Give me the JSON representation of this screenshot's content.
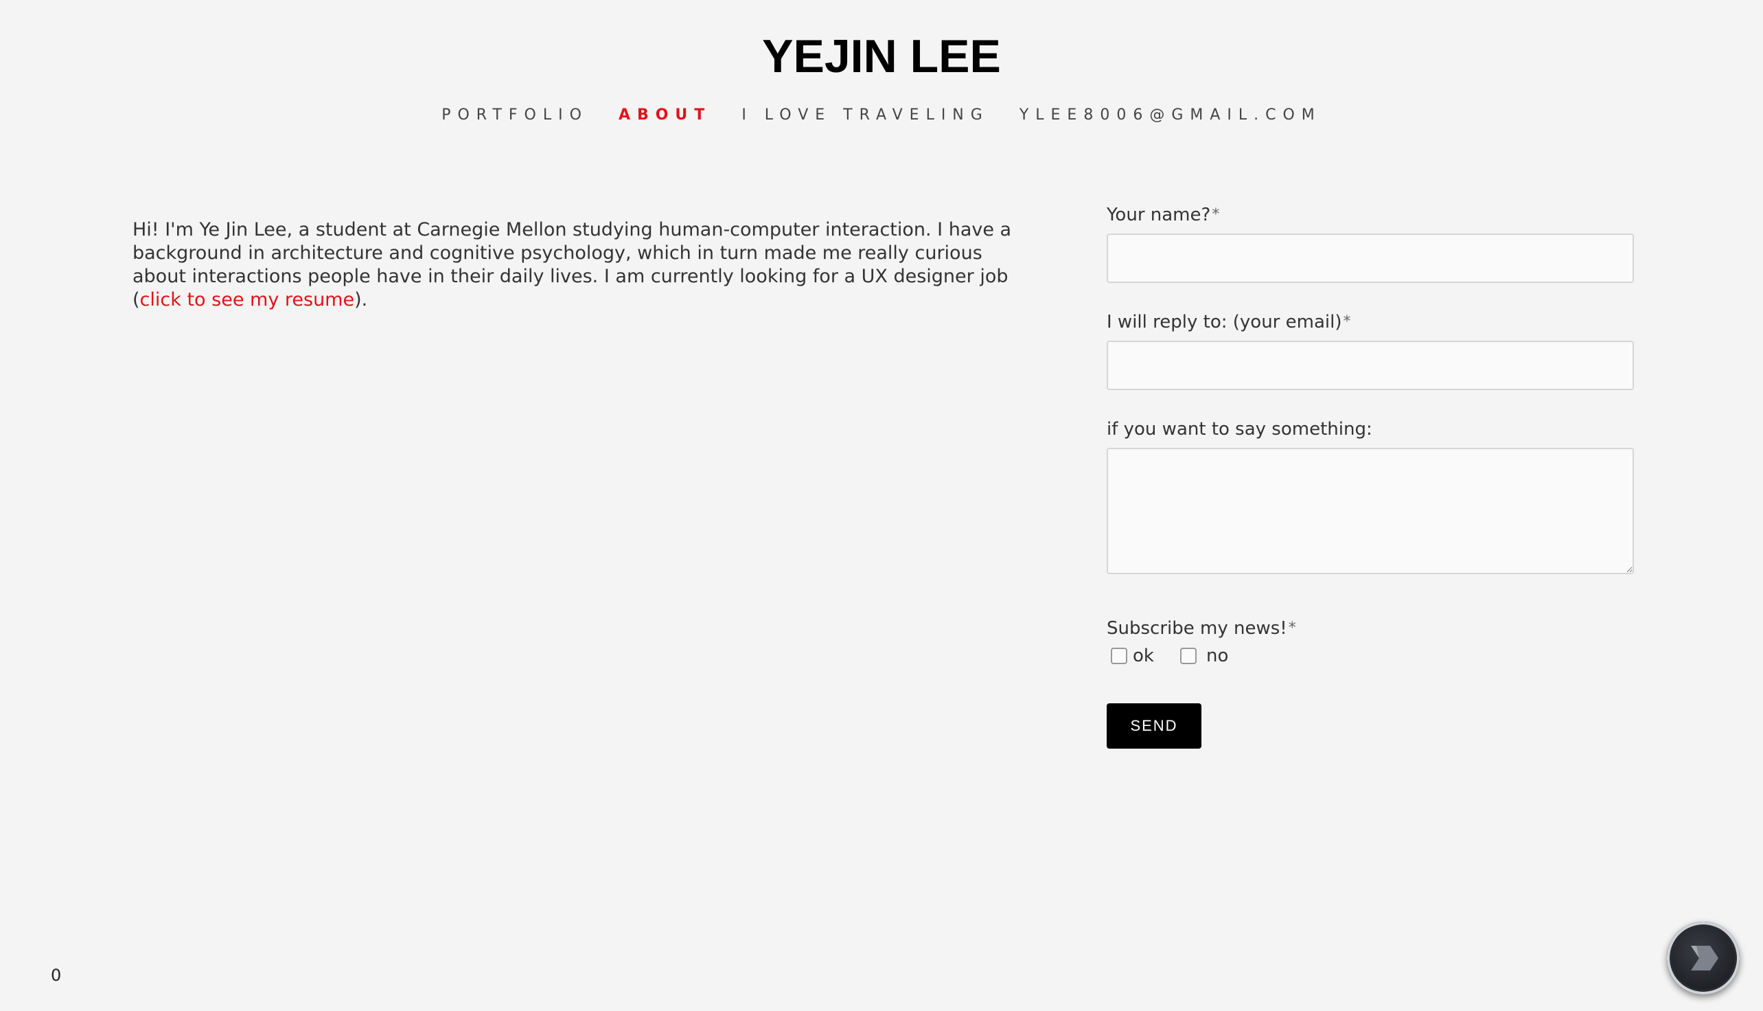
{
  "header": {
    "title": "YEJIN LEE"
  },
  "nav": {
    "items": [
      {
        "label": "PORTFOLIO",
        "active": false
      },
      {
        "label": "ABOUT",
        "active": true
      },
      {
        "label": "I LOVE TRAVELING",
        "active": false
      },
      {
        "label": "YLEE8006@GMAIL.COM",
        "active": false
      }
    ]
  },
  "bio": {
    "text": "Hi! I'm Ye Jin Lee, a student at Carnegie Mellon studying human-computer interaction. I have a background in architecture and cognitive psychology, which in turn made me really curious about interactions people have in their daily lives. I am currently looking for a UX designer job (",
    "link_text": "click to see my resume",
    "text_end": ")."
  },
  "form": {
    "name_label": "Your name?",
    "name_value": "",
    "email_label": "I will reply to: (your email)",
    "email_value": "",
    "message_label": "if you want to say something:",
    "message_value": "",
    "required_marker": "*",
    "subscribe_label": "Subscribe my news!",
    "options": [
      {
        "label": "ok",
        "checked": false
      },
      {
        "label": "no",
        "checked": false
      }
    ],
    "send_label": "SEND"
  },
  "footer": {
    "counter": "0"
  },
  "colors": {
    "accent": "#e3111a",
    "background": "#f4f4f4",
    "button": "#000000"
  },
  "icons": {
    "floating_button": "chevron-right-icon"
  }
}
